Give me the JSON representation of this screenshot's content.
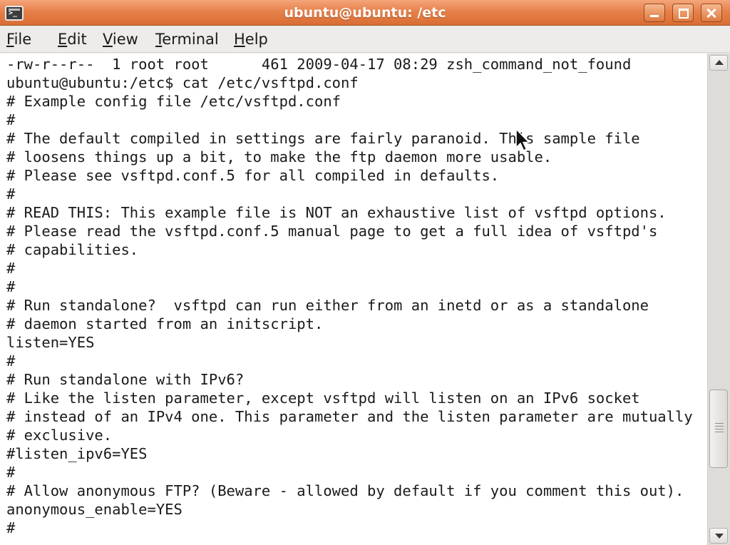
{
  "window": {
    "title": "ubuntu@ubuntu: /etc"
  },
  "menu": [
    {
      "mnemonic": "F",
      "rest": "ile"
    },
    {
      "mnemonic": "E",
      "rest": "dit"
    },
    {
      "mnemonic": "V",
      "rest": "iew"
    },
    {
      "mnemonic": "T",
      "rest": "erminal"
    },
    {
      "mnemonic": "H",
      "rest": "elp"
    }
  ],
  "terminal": {
    "lines": [
      "-rw-r--r--  1 root root      461 2009-04-17 08:29 zsh_command_not_found",
      "ubuntu@ubuntu:/etc$ cat /etc/vsftpd.conf",
      "# Example config file /etc/vsftpd.conf",
      "#",
      "# The default compiled in settings are fairly paranoid. This sample file",
      "# loosens things up a bit, to make the ftp daemon more usable.",
      "# Please see vsftpd.conf.5 for all compiled in defaults.",
      "#",
      "# READ THIS: This example file is NOT an exhaustive list of vsftpd options.",
      "# Please read the vsftpd.conf.5 manual page to get a full idea of vsftpd's",
      "# capabilities.",
      "#",
      "#",
      "# Run standalone?  vsftpd can run either from an inetd or as a standalone",
      "# daemon started from an initscript.",
      "listen=YES",
      "#",
      "# Run standalone with IPv6?",
      "# Like the listen parameter, except vsftpd will listen on an IPv6 socket",
      "# instead of an IPv4 one. This parameter and the listen parameter are mutually",
      "# exclusive.",
      "#listen_ipv6=YES",
      "#",
      "# Allow anonymous FTP? (Beware - allowed by default if you comment this out).",
      "anonymous_enable=YES",
      "#"
    ]
  },
  "scrollbar": {
    "position_fraction": 0.72
  },
  "colors": {
    "titlebar": "#e6814a",
    "terminal_bg": "#ffffff",
    "terminal_fg": "#1a1a1a",
    "menubar_bg": "#edeceb"
  },
  "icons": {
    "window": "terminal-icon",
    "minimize": "minimize-icon",
    "maximize": "maximize-icon",
    "close": "close-icon",
    "scroll_up": "arrow-up-icon",
    "scroll_down": "arrow-down-icon",
    "pointer": "mouse-pointer-icon"
  }
}
